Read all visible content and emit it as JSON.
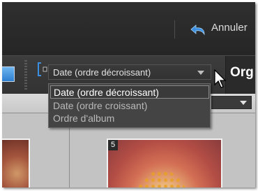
{
  "topbar": {
    "undo_label": "Annuler",
    "undo_icon": "undo-arrow-icon"
  },
  "toolbar": {
    "sort_select_value": "Date  (ordre décroissant)",
    "organizer_tab_label": "Org"
  },
  "sort_dropdown": {
    "options": [
      "Date  (ordre décroissant)",
      "Date  (ordre croissant)",
      "Ordre d'album"
    ],
    "selected_index": 0
  },
  "grid": {
    "badge_number": "5"
  },
  "colors": {
    "accent_blue": "#2e7fd0",
    "undo_icon_blue": "#3a8fe0"
  }
}
